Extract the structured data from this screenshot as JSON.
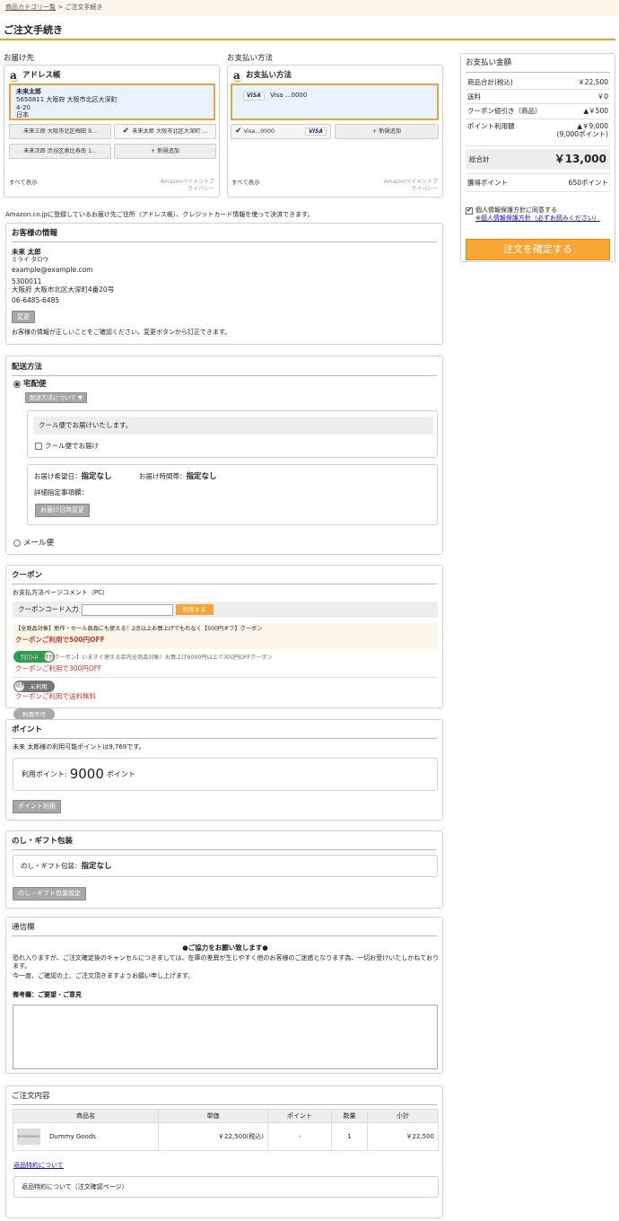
{
  "breadcrumb": {
    "home": "商品カテゴリ一覧",
    "sep": ">",
    "current": "ご注文手続き"
  },
  "page_title": "ご注文手続き",
  "address": {
    "section_label": "お届け先",
    "widget_title": "アドレス帳",
    "selected": {
      "name": "未来太郎",
      "line1": "5650811 大阪府 大阪市北区大深町",
      "line2": "4-20",
      "country": "日本"
    },
    "options": [
      "未来三郎 大阪市北区梅田 9...",
      "未来太郎 大阪市北区大深町 ...",
      "未来次郎 渋谷区恵比寿南 1...",
      "+ 新規追加"
    ],
    "show_all": "すべて表示",
    "footer_r1": "Amazonペイメントプ",
    "footer_r2": "ライバシー"
  },
  "payment": {
    "section_label": "お支払い方法",
    "widget_title": "お支払い方法",
    "selected": "Visa ...0000",
    "visa": "VISA",
    "options": [
      "Visa...0000",
      "+ 新規追加"
    ],
    "show_all": "すべて表示",
    "footer_r1": "Amazonペイメントプ",
    "footer_r2": "ライバシー"
  },
  "summary": {
    "title": "お支払い金額",
    "rows": [
      {
        "label": "商品合計(税込)",
        "value": "￥22,500"
      },
      {
        "label": "送料",
        "value": "￥0"
      },
      {
        "label": "クーポン値引き（商品）",
        "value": "▲￥500"
      },
      {
        "label": "ポイント利用額",
        "value": "▲￥9,000",
        "sub": "(9,000ポイント)"
      }
    ],
    "total_label": "総合計",
    "total_value": "￥13,000",
    "points_label": "獲得ポイント",
    "points_value": "650ポイント",
    "privacy_label": "個人情報保護方針に同意する",
    "privacy_link": "※個人情報保護方針（必ずお読みください）",
    "confirm_button": "注文を確定する"
  },
  "amazon_note": "Amazon.co.jpに登録しているお届け先ご住所（アドレス帳）、クレジットカード情報を使って決済できます。",
  "customer": {
    "title": "お客様の情報",
    "name": "未来 太郎",
    "kana": "ミライ タロウ",
    "email": "example@example.com",
    "zip": "5300011",
    "address": "大阪府 大阪市北区大深町4番20号",
    "phone": "06-6485-6485",
    "change_button": "変更",
    "note": "お客様の情報が正しいことをご確認ください。変更ボタンから訂正できます。"
  },
  "delivery": {
    "title": "配送方法",
    "method1": "宅配便",
    "about_button": "配送方法について ▼",
    "cool_notice": "クール便でお届けいたします。",
    "cool_check": "クール便でお届け",
    "date_label": "お届け希望日：",
    "date_value": "指定なし",
    "time_label": "お届け時間帯：",
    "time_value": "指定なし",
    "detail_label": "詳細指定事項欄：",
    "change_button": "お届け日時変更",
    "method2": "メール便"
  },
  "coupon": {
    "title": "クーポン",
    "comment": "お支払方法ページコメント（PC）",
    "input_label": "クーポンコード入力",
    "apply_button": "利用する",
    "items": [
      {
        "desc": "【全商品対象】新作・セール商品にも使える！2点以上お買上げでもれなく【500円オフ】クーポン",
        "name": "クーポンご利用で500円OFF",
        "status": "利用中"
      },
      {
        "desc": "【お誕生月特別クーポン】いますぐ使える店内全商品対象！お買上げ6000円以上で300円OFFクーポン",
        "name": "クーポンご利用で300円OFF",
        "status": "未利用"
      },
      {
        "desc": "送料無料",
        "name": "クーポンご利用で送料無料",
        "status": "利用不可"
      }
    ]
  },
  "points": {
    "title": "ポイント",
    "available": "未来 太郎様の利用可能ポイントは9,769です。",
    "use_label": "利用ポイント:",
    "use_value": "9000",
    "unit": "ポイント",
    "button": "ポイント利用"
  },
  "gift": {
    "title": "のし・ギフト包装",
    "label": "のし・ギフト包装：",
    "value": "指定なし",
    "button": "のし・ギフト包装設定"
  },
  "message": {
    "title": "通信欄",
    "notice_title": "●ご協力をお願い致します●",
    "notice_body": "恐れ入りますが、ご注文確定後のキャンセルにつきましては、在庫の差異が生じやすく他のお客様のご迷惑となります為、一切お受けいたしかねております。",
    "notice_body2": "今一度、ご確認の上、ご注文頂きますようお願い申し上げます。",
    "remarks_label": "備考欄：ご要望・ご意見"
  },
  "order": {
    "title": "ご注文内容",
    "headers": [
      "商品名",
      "単価",
      "ポイント",
      "数量",
      "小計"
    ],
    "rows": [
      {
        "name": "Dummy Goods",
        "price": "￥22,500(税込)",
        "points": "-",
        "qty": "1",
        "subtotal": "￥22,500"
      }
    ],
    "thumb_text": "DUMMYIMAGE",
    "return_link": "返品特約について",
    "return_box": "返品特約について（注文確認ページ）"
  }
}
